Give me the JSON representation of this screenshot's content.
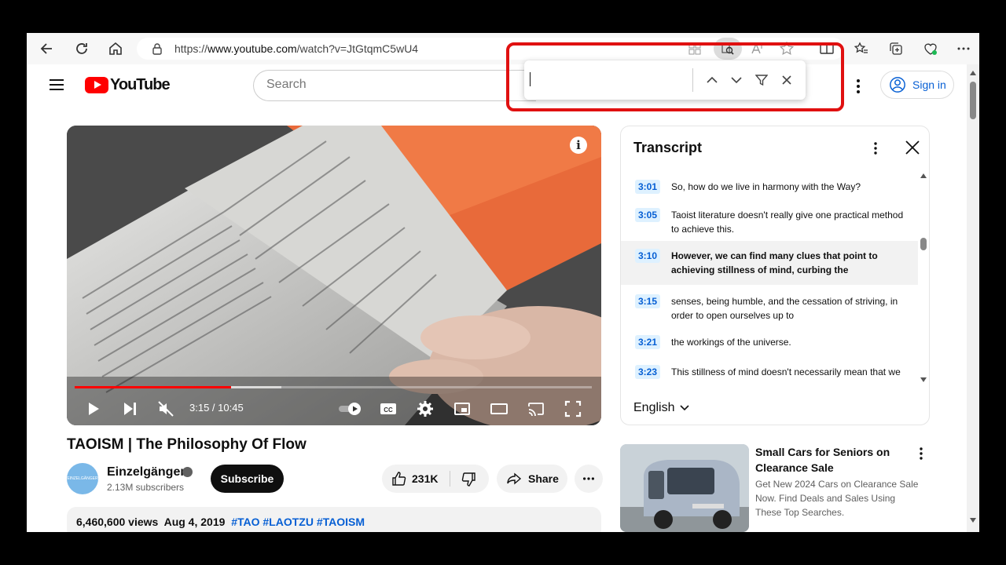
{
  "browser": {
    "url_prefix": "https://",
    "url_host": "www.youtube.com",
    "url_path": "/watch?v=JtGtqmC5wU4"
  },
  "find_bar": {
    "value": ""
  },
  "header": {
    "logo_text": "YouTube",
    "search_placeholder": "Search",
    "sign_in_label": "Sign in"
  },
  "video": {
    "current_time": "3:15",
    "duration": "10:45",
    "progress_fraction": 0.302,
    "buffered_fraction": 0.4,
    "title": "TAOISM | The Philosophy Of Flow",
    "channel_name": "Einzelgänger",
    "channel_avatar_text": "EINZELGÄNGER",
    "subscribers": "2.13M subscribers",
    "subscribe_label": "Subscribe",
    "likes": "231K",
    "share_label": "Share",
    "views": "6,460,600 views",
    "date": "Aug 4, 2019",
    "hashtags": [
      "#TAO",
      "#LAOTZU",
      "#TAOISM"
    ]
  },
  "transcript": {
    "title": "Transcript",
    "language": "English",
    "segments": [
      {
        "time": "3:01",
        "text": "So, how do we live in harmony with the Way?",
        "active": false
      },
      {
        "time": "3:05",
        "text": "Taoist literature doesn't really give one practical method to achieve this.",
        "active": false
      },
      {
        "time": "3:10",
        "text": "However, we can find many clues that point to achieving stillness of mind, curbing the",
        "active": true
      },
      {
        "time": "3:15",
        "text": "senses, being humble, and the cessation of striving, in order to open ourselves up to",
        "active": false
      },
      {
        "time": "3:21",
        "text": "the workings of the universe.",
        "active": false
      },
      {
        "time": "3:23",
        "text": "This stillness of mind doesn't necessarily mean that we",
        "active": false
      }
    ]
  },
  "ad": {
    "title": "Small Cars for Seniors on Clearance Sale",
    "description": "Get New 2024 Cars on Clearance Sale Now. Find Deals and Sales Using These Top Searches."
  },
  "colors": {
    "accent_red": "#ff0000",
    "link_blue": "#065fd4",
    "annotation_red": "#e01010"
  }
}
